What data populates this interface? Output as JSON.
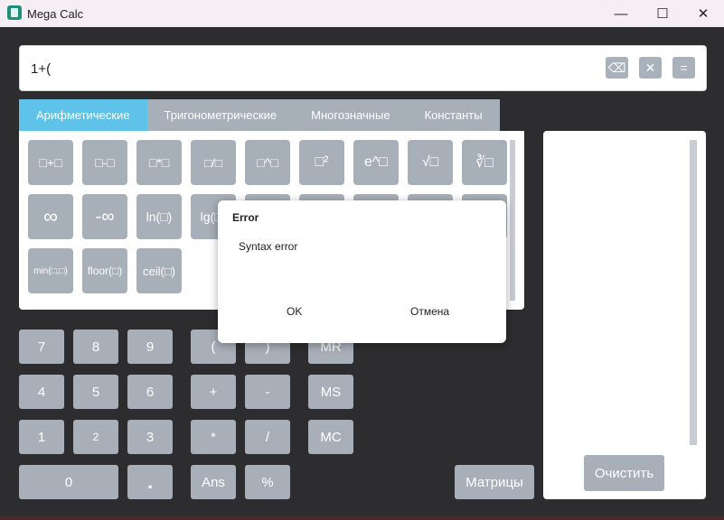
{
  "window": {
    "title": "Mega Calc",
    "minimize": "—",
    "maximize": "☐",
    "close": "✕"
  },
  "display": {
    "expression": "1+(",
    "backspace": "⌫",
    "clear": "✕",
    "equals": "="
  },
  "tabs": [
    "Арифметические",
    "Тригонометрические",
    "Многозначные",
    "Константы"
  ],
  "functions": {
    "row1": [
      "□+□",
      "□-□",
      "□*□",
      "□/□",
      "□^□",
      "□²",
      "e^□",
      "√□",
      "∛□"
    ],
    "row2": [
      "∞",
      "-∞",
      "ln(□)",
      "lg(□)"
    ],
    "row3": [
      "min(□,□)",
      "floor(□)",
      "ceil(□)"
    ]
  },
  "keypad": {
    "digits": [
      "7",
      "8",
      "9",
      "4",
      "5",
      "6",
      "1",
      "2",
      "3",
      "0",
      "."
    ],
    "ops": [
      "(",
      ")",
      "+",
      "-",
      "*",
      "/",
      "Ans",
      "%"
    ],
    "memory": [
      "MR",
      "MS",
      "MC"
    ]
  },
  "matrices": "Матрицы",
  "history": {
    "clear": "Очистить"
  },
  "dialog": {
    "title": "Error",
    "message": "Syntax error",
    "ok": "OK",
    "cancel": "Отмена"
  },
  "colors": {
    "accent": "#5fc2e8",
    "button": "#a7afb9",
    "background": "#2d2d2f"
  }
}
